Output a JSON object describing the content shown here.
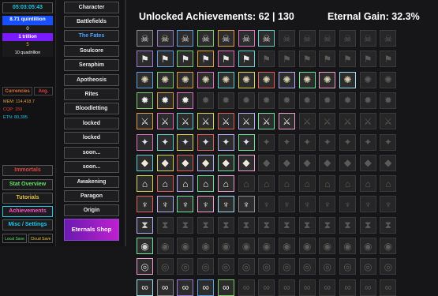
{
  "left_panel": {
    "timer": "05:03:05:43",
    "stats": {
      "quintillion": "8.71 quintillion",
      "zero": "0",
      "trillion": "1 trillion",
      "five": "5",
      "quadrillion": "10 quadrillion"
    },
    "currencies_tab": "Currencies",
    "avg_tab": "Avg.",
    "mem": "MEM: 114,418.7",
    "cqp": "CQP: 159",
    "etn": "ETN: 80,395",
    "nav": [
      "Immortals",
      "Stat Overview",
      "Tutorials",
      "Achievements",
      "Misc / Settings"
    ],
    "local_save": "Local Save",
    "cloud_save": "Cloud Save"
  },
  "menu": {
    "items": [
      "Character",
      "Battlefields",
      "The Fates",
      "Soulcore",
      "Seraphim",
      "Apotheosis",
      "Rites",
      "Bloodletting",
      "locked",
      "locked",
      "soon...",
      "soon...",
      "Awakening",
      "Paragon",
      "Origin"
    ],
    "shop": "Eternals Shop"
  },
  "header": {
    "unlocked_achievements": "Unlocked Achievements: 62 | 130",
    "eternal_gain": "Eternal Gain: 32.3%"
  },
  "achievements": {
    "rows": [
      {
        "icon": "skull",
        "glyph": "☠",
        "color": "#e0e0e0",
        "unlocked": 7,
        "count": 13
      },
      {
        "icon": "battle-flag",
        "glyph": "⚑",
        "color": "#e8e8e8",
        "unlocked": 6,
        "count": 13
      },
      {
        "icon": "vortex",
        "glyph": "✺",
        "color": "#d8cfb0",
        "unlocked": 11,
        "count": 13
      },
      {
        "icon": "flame",
        "glyph": "✹",
        "color": "#f0f0f0",
        "unlocked": 3,
        "count": 13
      },
      {
        "icon": "leaping-figure",
        "glyph": "⚔",
        "color": "#f0f0f0",
        "unlocked": 8,
        "count": 13
      },
      {
        "icon": "sparkle-wand",
        "glyph": "✦",
        "color": "#e0e0f0",
        "unlocked": 6,
        "count": 13
      },
      {
        "icon": "gem",
        "glyph": "◆",
        "color": "#f0e8d8",
        "unlocked": 6,
        "count": 13
      },
      {
        "icon": "temple",
        "glyph": "⌂",
        "color": "#f0f0f0",
        "unlocked": 5,
        "count": 13
      },
      {
        "icon": "horned-helm",
        "glyph": "♆",
        "color": "#f0f0f0",
        "unlocked": 6,
        "count": 13
      },
      {
        "icon": "hourglass",
        "glyph": "⧗",
        "color": "#d0d0d0",
        "unlocked": 1,
        "count": 13
      },
      {
        "icon": "eye",
        "glyph": "◉",
        "color": "#d0d0d0",
        "unlocked": 1,
        "count": 13
      },
      {
        "icon": "swirl",
        "glyph": "◎",
        "color": "#d0d0d0",
        "unlocked": 1,
        "count": 13
      },
      {
        "icon": "infinity-knot",
        "glyph": "∞",
        "color": "#f0f0f0",
        "unlocked": 5,
        "count": 13
      }
    ],
    "border_palette": [
      "#8b8b8b",
      "#9a7cd8",
      "#5fa0e0",
      "#7ccf6a",
      "#e0a040",
      "#e070c0",
      "#60d0d0",
      "#d8d850",
      "#e06060",
      "#b0b0ff",
      "#70e0a0",
      "#f0a0d0",
      "#a0e0f0"
    ]
  },
  "colors": {
    "accent_cyan": "#1ec8e8",
    "purple_stat": "#7a1aff",
    "blue_stat": "#1a4fff",
    "immortals_red": "#e04040",
    "achievements_active": "#ff4fc8",
    "shop_gradient_start": "#6a1ab0",
    "shop_gradient_end": "#c020d0"
  }
}
